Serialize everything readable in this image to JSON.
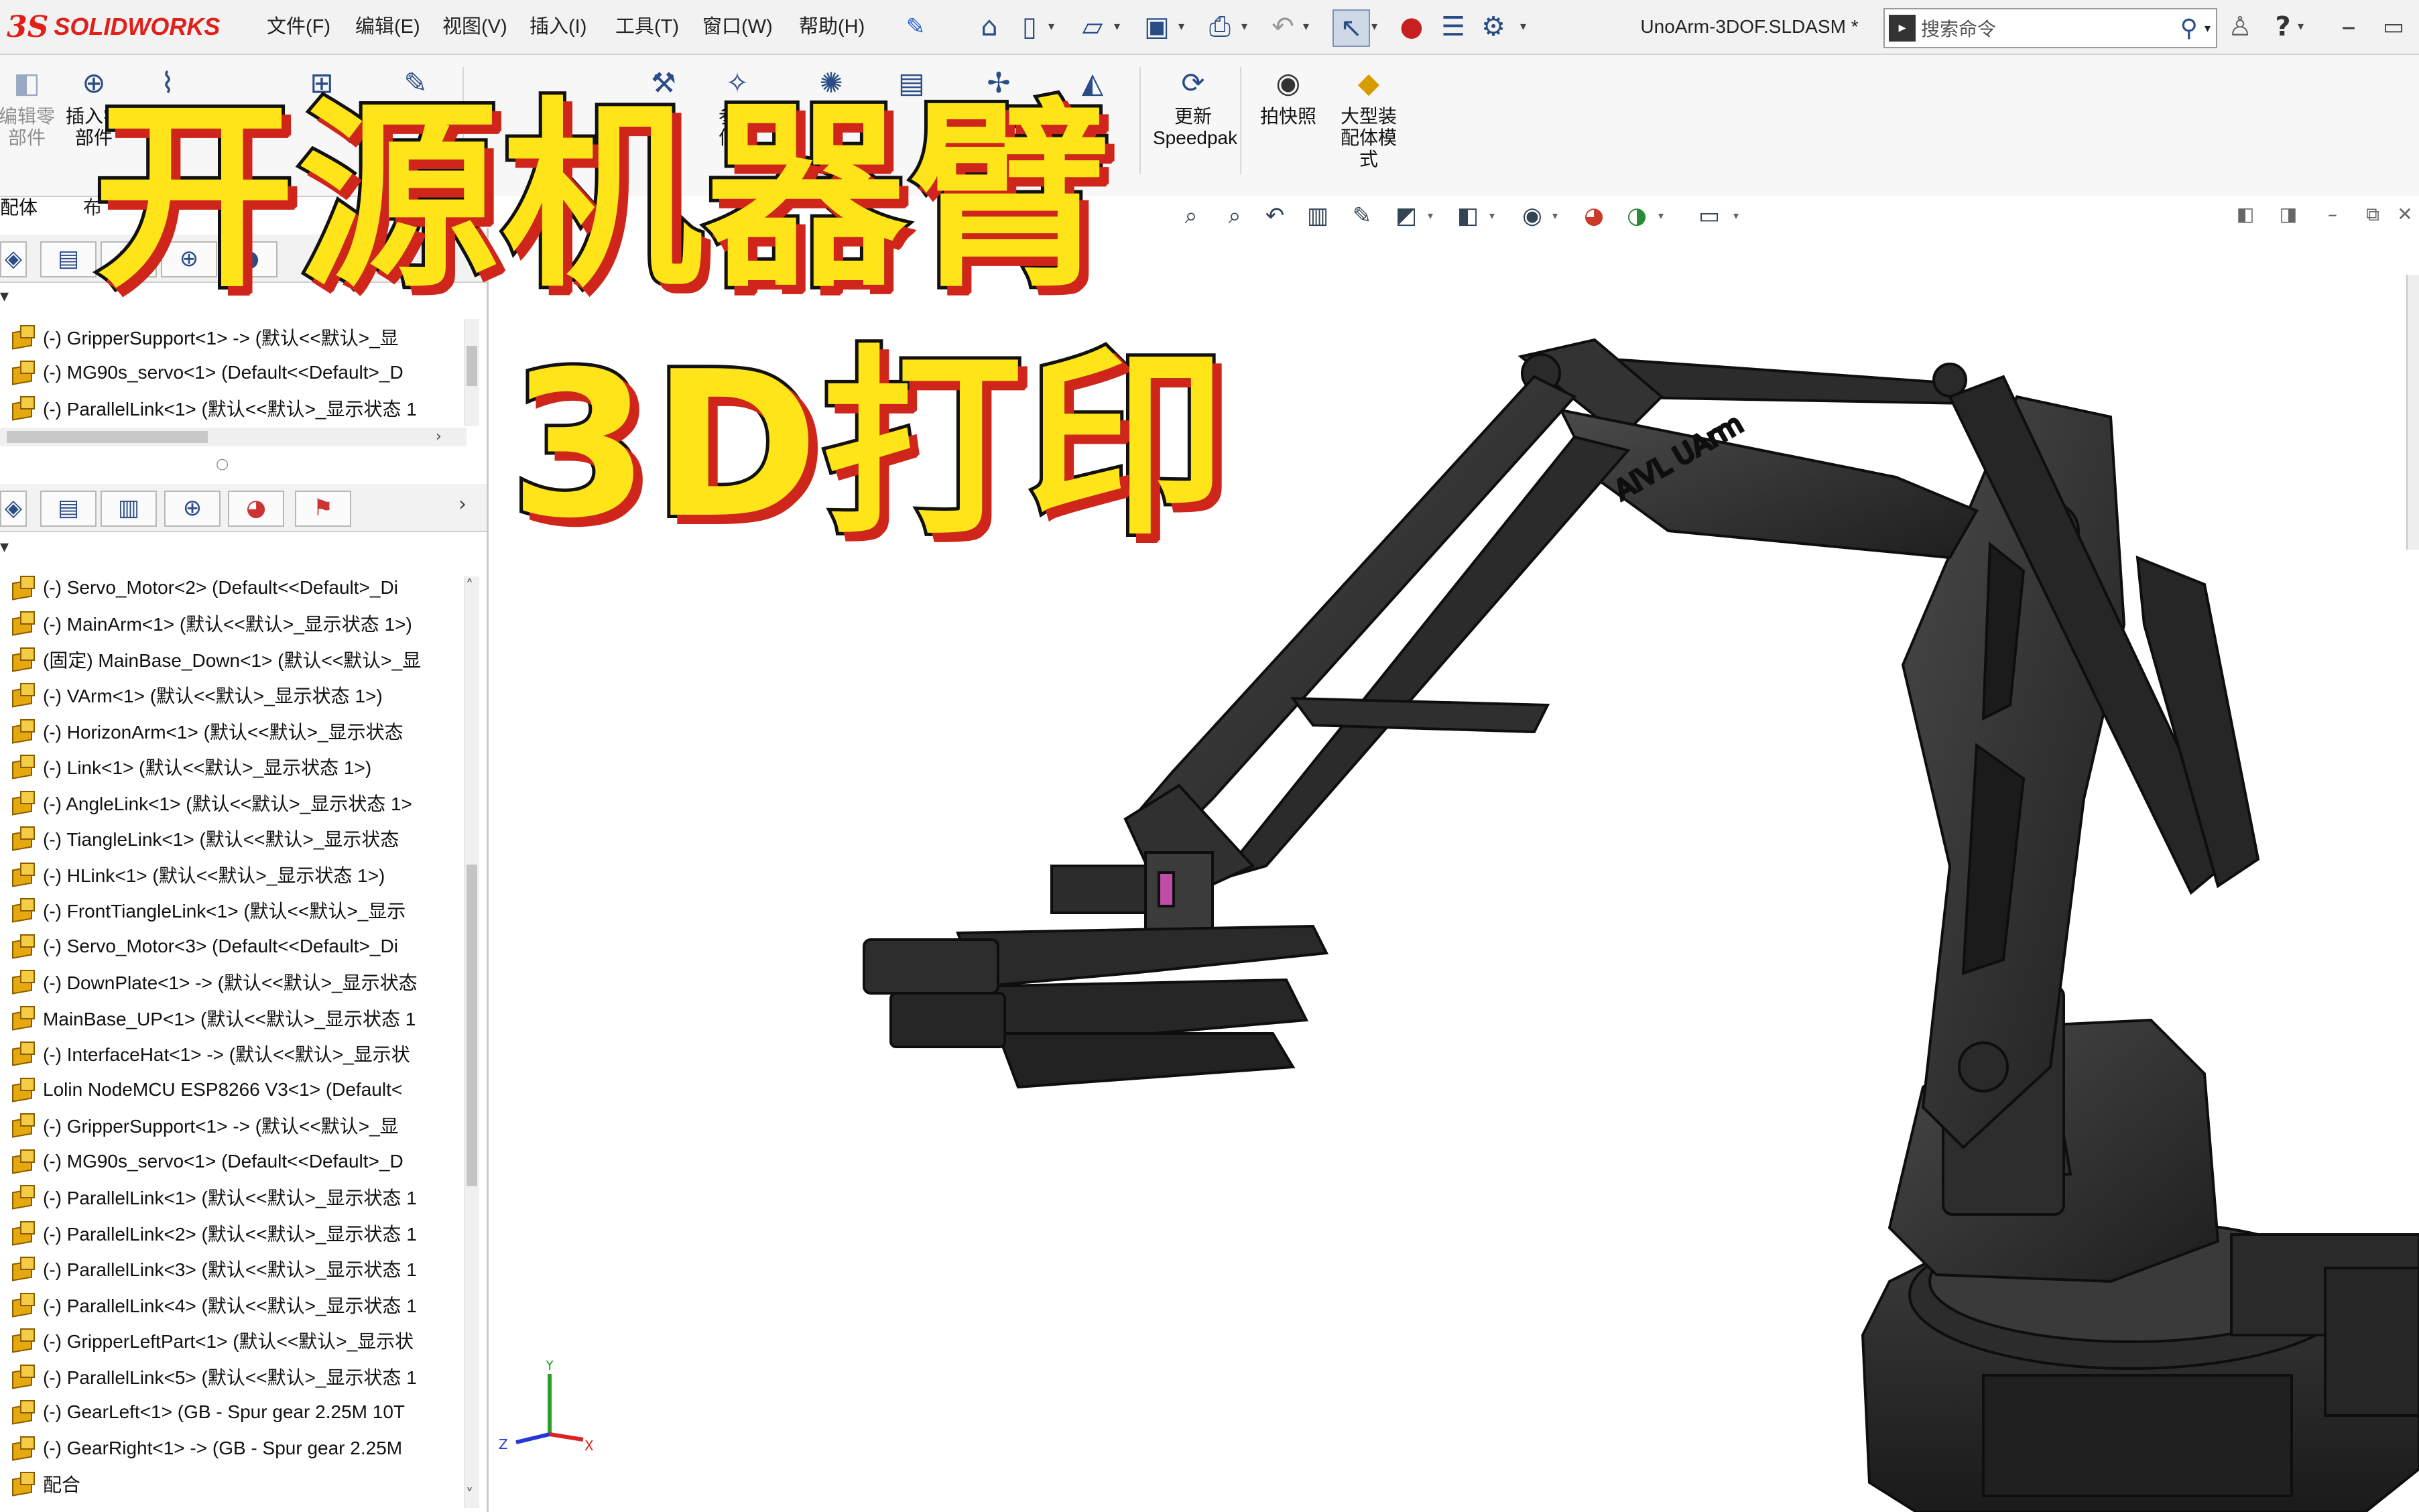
{
  "app": {
    "logo_ds": "3S",
    "logo_text": "SOLIDWORKS",
    "document_title": "UnoArm-3DOF.SLDASM *",
    "search_placeholder": "搜索命令"
  },
  "menu": [
    {
      "label": "文件(F)"
    },
    {
      "label": "编辑(E)"
    },
    {
      "label": "视图(V)"
    },
    {
      "label": "插入(I)"
    },
    {
      "label": "工具(T)"
    },
    {
      "label": "窗口(W)"
    },
    {
      "label": "帮助(H)"
    }
  ],
  "ribbon": {
    "edit_component_line1": "编辑零",
    "edit_component_line2": "部件",
    "insert_component_line1": "插入零",
    "insert_component_line2": "部件",
    "ref_geom_line1": "参考",
    "ref_geom_line2": "何体",
    "update_speedpak_line1": "更新",
    "update_speedpak_line2": "Speedpak",
    "snapshot": "拍快照",
    "large_asm_line1": "大型装",
    "large_asm_line2": "配体模",
    "large_asm_line3": "式"
  },
  "tabs": {
    "assembly": "配体",
    "layout": "布"
  },
  "tree_top": [
    {
      "label": "(-) GripperSupport<1> -> (默认<<默认>_显"
    },
    {
      "label": "(-) MG90s_servo<1> (Default<<Default>_D"
    },
    {
      "label": "(-) ParallelLink<1> (默认<<默认>_显示状态 1"
    }
  ],
  "tree_bottom": [
    {
      "label": "(-) Servo_Motor<2> (Default<<Default>_Di"
    },
    {
      "label": "(-) MainArm<1> (默认<<默认>_显示状态 1>)"
    },
    {
      "label": "(固定) MainBase_Down<1> (默认<<默认>_显"
    },
    {
      "label": "(-) VArm<1> (默认<<默认>_显示状态 1>)"
    },
    {
      "label": "(-) HorizonArm<1> (默认<<默认>_显示状态"
    },
    {
      "label": "(-) Link<1> (默认<<默认>_显示状态 1>)"
    },
    {
      "label": "(-) AngleLink<1> (默认<<默认>_显示状态 1>"
    },
    {
      "label": "(-) TiangleLink<1> (默认<<默认>_显示状态"
    },
    {
      "label": "(-) HLink<1> (默认<<默认>_显示状态 1>)"
    },
    {
      "label": "(-) FrontTiangleLink<1> (默认<<默认>_显示"
    },
    {
      "label": "(-) Servo_Motor<3> (Default<<Default>_Di"
    },
    {
      "label": "(-) DownPlate<1> -> (默认<<默认>_显示状态"
    },
    {
      "label": "MainBase_UP<1> (默认<<默认>_显示状态 1"
    },
    {
      "label": "(-) InterfaceHat<1> -> (默认<<默认>_显示状"
    },
    {
      "label": "Lolin NodeMCU ESP8266 V3<1> (Default<"
    },
    {
      "label": "(-) GripperSupport<1> -> (默认<<默认>_显"
    },
    {
      "label": "(-) MG90s_servo<1> (Default<<Default>_D"
    },
    {
      "label": "(-) ParallelLink<1> (默认<<默认>_显示状态 1"
    },
    {
      "label": "(-) ParallelLink<2> (默认<<默认>_显示状态 1"
    },
    {
      "label": "(-) ParallelLink<3> (默认<<默认>_显示状态 1"
    },
    {
      "label": "(-) ParallelLink<4> (默认<<默认>_显示状态 1"
    },
    {
      "label": "(-) GripperLeftPart<1> (默认<<默认>_显示状"
    },
    {
      "label": "(-) ParallelLink<5> (默认<<默认>_显示状态 1"
    },
    {
      "label": "(-) GearLeft<1> (GB - Spur gear 2.25M 10T"
    },
    {
      "label": "(-) GearRight<1> -> (GB - Spur gear 2.25M"
    },
    {
      "label": "配合"
    }
  ],
  "overlay": {
    "line1": "开源机器臂",
    "line2": "3D打印"
  },
  "model": {
    "arm_text": "AIVL UArm"
  },
  "triad": {
    "x": "X",
    "y": "Y",
    "z": "Z"
  },
  "colors": {
    "brand_red": "#e0211b",
    "overlay_yellow": "#ffe41a",
    "overlay_outline": "#111111",
    "overlay_shadow": "#d0251b",
    "model_dark": "#2b2b2b",
    "component_icon": "#e6a80f"
  }
}
